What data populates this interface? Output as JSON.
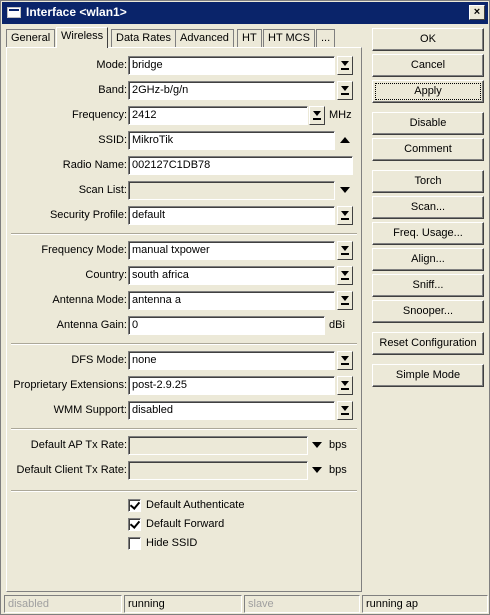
{
  "window": {
    "title": "Interface <wlan1>",
    "close_glyph": "×"
  },
  "tabs": [
    "General",
    "Wireless",
    "Data Rates",
    "Advanced",
    "HT",
    "HT MCS",
    "..."
  ],
  "form": {
    "mode": {
      "label": "Mode:",
      "value": "bridge"
    },
    "band": {
      "label": "Band:",
      "value": "2GHz-b/g/n"
    },
    "frequency": {
      "label": "Frequency:",
      "value": "2412",
      "unit": "MHz"
    },
    "ssid": {
      "label": "SSID:",
      "value": "MikroTik"
    },
    "radio_name": {
      "label": "Radio Name:",
      "value": "002127C1DB78"
    },
    "scan_list": {
      "label": "Scan List:",
      "value": ""
    },
    "security_profile": {
      "label": "Security Profile:",
      "value": "default"
    },
    "frequency_mode": {
      "label": "Frequency Mode:",
      "value": "manual txpower"
    },
    "country": {
      "label": "Country:",
      "value": "south africa"
    },
    "antenna_mode": {
      "label": "Antenna Mode:",
      "value": "antenna a"
    },
    "antenna_gain": {
      "label": "Antenna Gain:",
      "value": "0",
      "unit": "dBi"
    },
    "dfs_mode": {
      "label": "DFS Mode:",
      "value": "none"
    },
    "proprietary_extensions": {
      "label": "Proprietary Extensions:",
      "value": "post-2.9.25"
    },
    "wmm_support": {
      "label": "WMM Support:",
      "value": "disabled"
    },
    "default_ap_tx_rate": {
      "label": "Default AP Tx Rate:",
      "value": "",
      "unit": "bps"
    },
    "default_client_tx_rate": {
      "label": "Default Client Tx Rate:",
      "value": "",
      "unit": "bps"
    },
    "default_authenticate": {
      "label": "Default Authenticate",
      "checked": true
    },
    "default_forward": {
      "label": "Default Forward",
      "checked": true
    },
    "hide_ssid": {
      "label": "Hide SSID",
      "checked": false
    }
  },
  "buttons": {
    "ok": "OK",
    "cancel": "Cancel",
    "apply": "Apply",
    "disable": "Disable",
    "comment": "Comment",
    "torch": "Torch",
    "scan": "Scan...",
    "freq_usage": "Freq. Usage...",
    "align": "Align...",
    "sniff": "Sniff...",
    "snooper": "Snooper...",
    "reset_configuration": "Reset Configuration",
    "simple_mode": "Simple Mode"
  },
  "status": [
    "disabled",
    "running",
    "slave",
    "running ap"
  ]
}
